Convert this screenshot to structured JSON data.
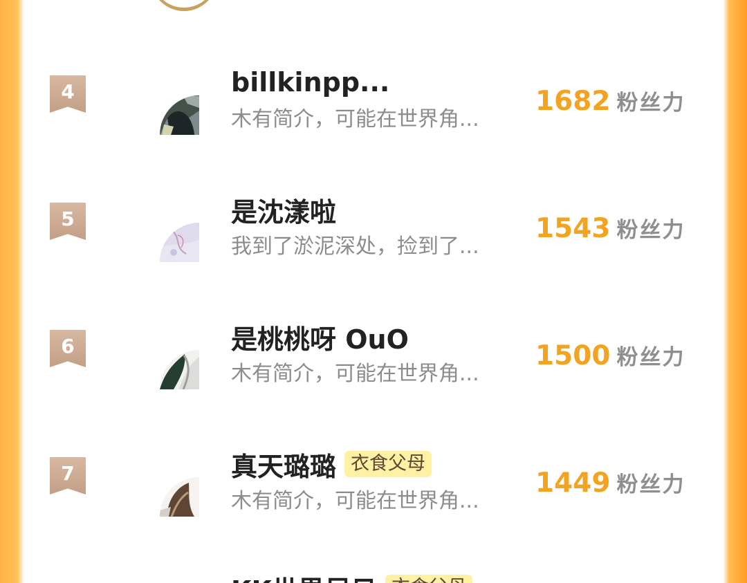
{
  "rankings": [
    {
      "rank": "4",
      "name": "billkinpp...",
      "tag": "",
      "bio": "木有简介，可能在世界角...",
      "score": "1682",
      "score_label": "粉丝力",
      "avatar_icon": "photo-avatar-dark-figure"
    },
    {
      "rank": "5",
      "name": "是沈漾啦",
      "tag": "",
      "bio": "我到了淤泥深处，捡到了...",
      "score": "1543",
      "score_label": "粉丝力",
      "avatar_icon": "photo-avatar-pale-sketch"
    },
    {
      "rank": "6",
      "name": "是桃桃呀 OuO",
      "tag": "",
      "bio": "木有简介，可能在世界角...",
      "score": "1500",
      "score_label": "粉丝力",
      "avatar_icon": "photo-avatar-dark-leaf"
    },
    {
      "rank": "7",
      "name": "真天璐璐",
      "tag": "衣食父母",
      "bio": "木有简介，可能在世界角...",
      "score": "1449",
      "score_label": "粉丝力",
      "avatar_icon": "photo-avatar-brown-hair"
    },
    {
      "rank": "",
      "name": "KK世界尽日",
      "tag": "衣食父母",
      "bio": "",
      "score": "",
      "score_label": "",
      "avatar_icon": "cropped-row-avatar"
    }
  ]
}
